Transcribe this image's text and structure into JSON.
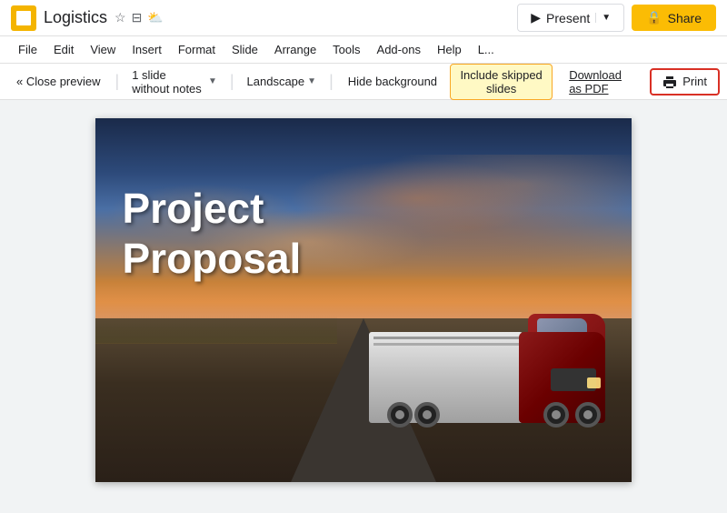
{
  "titleBar": {
    "appTitle": "Logistics",
    "presentLabel": "Present",
    "shareLabel": "Share",
    "lockIcon": "🔒",
    "starIcon": "☆",
    "driveIcon": "🗁",
    "cloudIcon": "☁"
  },
  "menuBar": {
    "items": [
      "File",
      "Edit",
      "View",
      "Insert",
      "Format",
      "Slide",
      "Arrange",
      "Tools",
      "Add-ons",
      "Help",
      "L..."
    ]
  },
  "printToolbar": {
    "closePrevLabel": "« Close preview",
    "slidesLabel": "1 slide without notes",
    "orientationLabel": "Landscape",
    "hideBackgroundLabel": "Hide background",
    "includeSkippedLabel": "Include skipped slides",
    "downloadPdfLabel": "Download as PDF",
    "printLabel": "Print"
  },
  "slide": {
    "titleLine1": "Project",
    "titleLine2": "Proposal"
  }
}
